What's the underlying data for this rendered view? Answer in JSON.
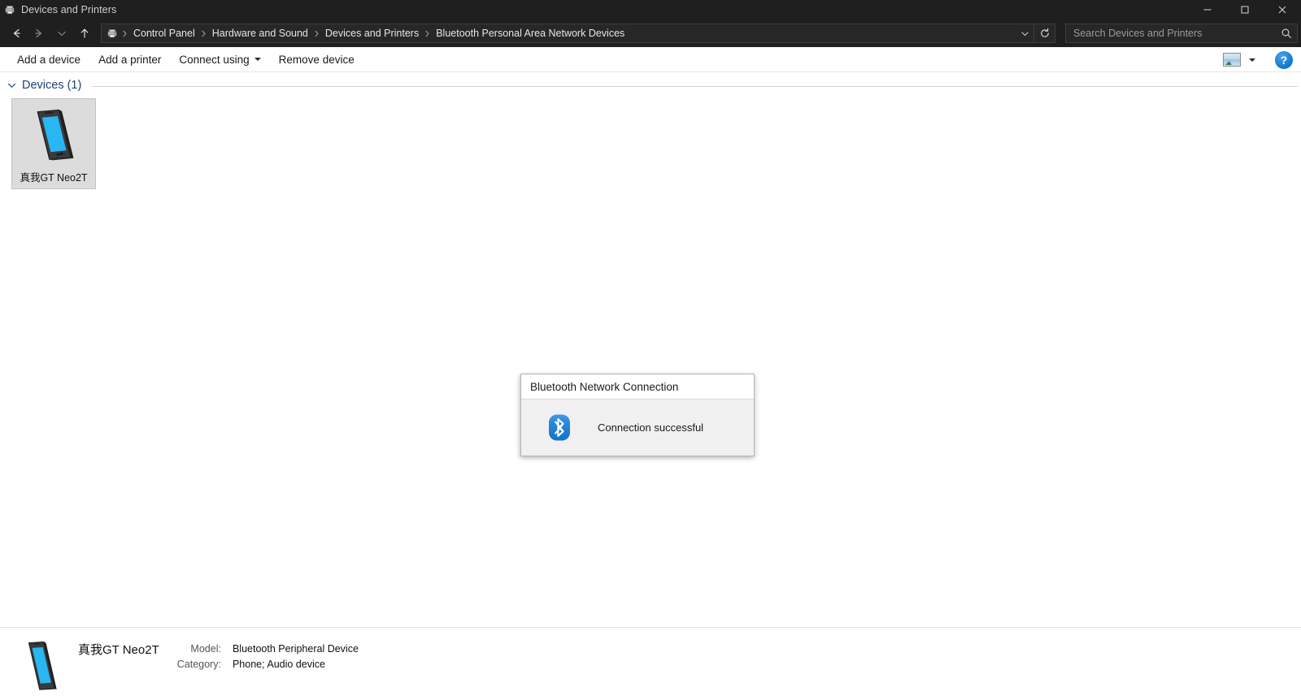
{
  "window": {
    "title": "Devices and Printers",
    "title_icon": "devices-and-printers-icon",
    "controls": {
      "minimize": "Minimize",
      "maximize": "Restore",
      "close": "Close"
    }
  },
  "navbar": {
    "back": "Back",
    "forward": "Forward",
    "recent": "Recent locations",
    "up": "Up",
    "breadcrumb_icon": "devices-and-printers-icon",
    "breadcrumbs": [
      "Control Panel",
      "Hardware and Sound",
      "Devices and Printers",
      "Bluetooth Personal Area Network Devices"
    ],
    "dropdown": "Previous locations",
    "refresh": "Refresh",
    "search": {
      "value": "",
      "placeholder": "Search Devices and Printers",
      "icon": "search-icon"
    }
  },
  "toolbar": {
    "items": [
      {
        "label": "Add a device",
        "has_caret": false
      },
      {
        "label": "Add a printer",
        "has_caret": false
      },
      {
        "label": "Connect using",
        "has_caret": true
      },
      {
        "label": "Remove device",
        "has_caret": false
      }
    ],
    "view_icon": "change-view-icon",
    "view_caret": "chevron-down-icon",
    "help_label": "?"
  },
  "content": {
    "group": {
      "chevron": "chevron-down-icon",
      "title": "Devices (1)"
    },
    "devices": [
      {
        "name": "真我GT Neo2T",
        "icon": "phone-icon",
        "selected": true
      }
    ]
  },
  "dialog": {
    "title": "Bluetooth Network Connection",
    "icon": "bluetooth-icon",
    "message": "Connection successful"
  },
  "statusbar": {
    "icon": "phone-icon",
    "device_name": "真我GT Neo2T",
    "fields": [
      {
        "key": "Model:",
        "value": "Bluetooth Peripheral Device"
      },
      {
        "key": "Category:",
        "value": "Phone; Audio device"
      }
    ]
  },
  "colors": {
    "titlebar_bg": "#1f1f1f",
    "accent_blue": "#1a7fd4",
    "bluetooth_blue": "#1782e0",
    "phone_screen": "#29b6f2",
    "group_title": "#1f3f73",
    "selection_bg": "#dcdcdc"
  }
}
